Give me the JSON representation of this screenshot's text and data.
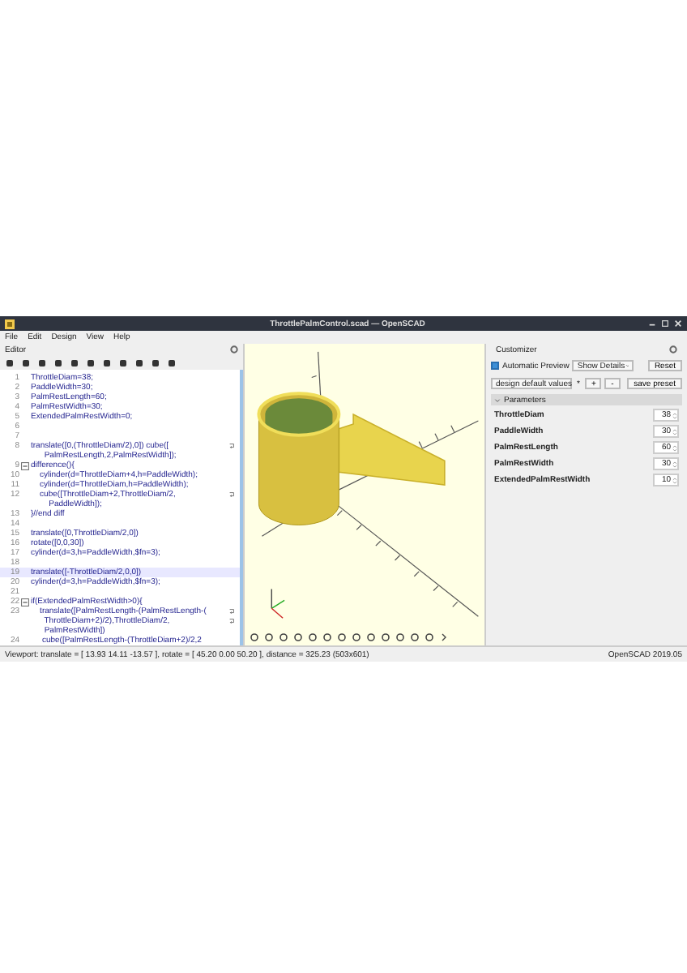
{
  "window": {
    "title": "ThrottlePalmControl.scad — OpenSCAD"
  },
  "menu": [
    "File",
    "Edit",
    "Design",
    "View",
    "Help"
  ],
  "editor": {
    "title": "Editor",
    "lines": [
      {
        "number": "1",
        "segments": [
          "ThrottleDiam=38;"
        ],
        "current": false
      },
      {
        "number": "2",
        "segments": [
          "PaddleWidth=30;"
        ],
        "current": false
      },
      {
        "number": "3",
        "segments": [
          "PalmRestLength=60;"
        ],
        "current": false
      },
      {
        "number": "4",
        "segments": [
          "PalmRestWidth=30;"
        ],
        "current": false
      },
      {
        "number": "5",
        "segments": [
          "ExtendedPalmRestWidth=0;"
        ],
        "current": false
      },
      {
        "number": "6",
        "current": false
      },
      {
        "number": "7",
        "current": false
      },
      {
        "number": "8",
        "segments": [
          "translate([0,(ThrottleDiam/2),0]) cube([",
          "      PalmRestLength,2,PalmRestWidth]);"
        ],
        "current": false
      },
      {
        "number": "9",
        "segments": [
          "difference(){"
        ],
        "current": false,
        "folded": false
      },
      {
        "number": "10",
        "segments": [
          "    cylinder(d=ThrottleDiam+4,h=PaddleWidth);"
        ],
        "current": false
      },
      {
        "number": "11",
        "segments": [
          "    cylinder(d=ThrottleDiam,h=PaddleWidth);"
        ],
        "current": false
      },
      {
        "number": "12",
        "segments": [
          "    cube([ThrottleDiam+2,ThrottleDiam/2,",
          "        PaddleWidth]);"
        ],
        "current": false
      },
      {
        "number": "13",
        "segments": [
          "}//end diff"
        ],
        "current": false
      },
      {
        "number": "14",
        "current": false
      },
      {
        "number": "15",
        "segments": [
          "translate([0,ThrottleDiam/2,0])"
        ],
        "current": false
      },
      {
        "number": "16",
        "segments": [
          "rotate([0,0,30])"
        ],
        "current": false
      },
      {
        "number": "17",
        "segments": [
          "cylinder(d=3,h=PaddleWidth,$fn=3);"
        ],
        "current": false
      },
      {
        "number": "18",
        "current": false
      },
      {
        "number": "19",
        "segments": [
          "translate([-ThrottleDiam/2,0,0])"
        ],
        "current": true
      },
      {
        "number": "20",
        "segments": [
          "cylinder(d=3,h=PaddleWidth,$fn=3);"
        ],
        "current": false
      },
      {
        "number": "21",
        "current": false
      },
      {
        "number": "22",
        "segments": [
          "if(ExtendedPalmRestWidth>0){"
        ],
        "current": false,
        "folded": false
      },
      {
        "number": "23",
        "segments": [
          "    translate([PalmRestLength-(PalmRestLength-(",
          "      ThrottleDiam+2)/2),ThrottleDiam/2,",
          "      PalmRestWidth])"
        ],
        "current": false
      },
      {
        "number": "24",
        "segments": [
          "     cube([PalmRestLength-(ThrottleDiam+2)/2,2"
        ],
        "current": false
      }
    ]
  },
  "customizer": {
    "title": "Customizer",
    "automatic_preview": {
      "label": "Automatic Preview",
      "checked": true
    },
    "details": "Show Details",
    "reset": "Reset",
    "preset": "design default values",
    "preset_marker": "*",
    "add": "+",
    "remove": "-",
    "save": "save preset",
    "section": {
      "title": "Parameters",
      "expanded": true
    },
    "parameters": [
      {
        "name": "ThrottleDiam",
        "value": "38"
      },
      {
        "name": "PaddleWidth",
        "value": "30"
      },
      {
        "name": "PalmRestLength",
        "value": "60"
      },
      {
        "name": "PalmRestWidth",
        "value": "30"
      },
      {
        "name": "ExtendedPalmRestWidth",
        "value": "10"
      }
    ]
  },
  "status_bar": {
    "viewport": "Viewport: translate = [ 13.93 14.11 -13.57 ], rotate = [ 45.20 0.00 50.20 ], distance = 325.23 (503x601)",
    "version": "OpenSCAD 2019.05"
  }
}
